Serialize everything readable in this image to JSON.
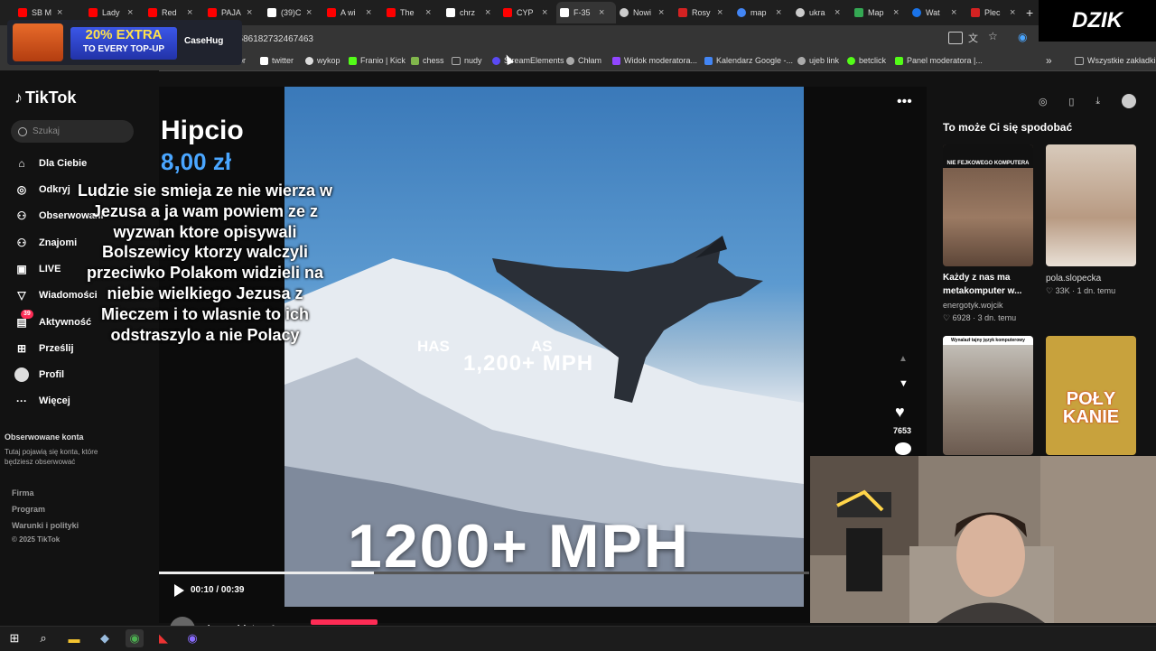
{
  "browser": {
    "tabs": [
      {
        "label": "SB M",
        "icon_color": "#ff0000"
      },
      {
        "label": "Lady",
        "icon_color": "#ff0000"
      },
      {
        "label": "Red",
        "icon_color": "#ff0000"
      },
      {
        "label": "PAJA",
        "icon_color": "#ff0000"
      },
      {
        "label": "(39)C",
        "icon_color": "#ffffff"
      },
      {
        "label": "A wi",
        "icon_color": "#ff0000"
      },
      {
        "label": "The",
        "icon_color": "#ff0000"
      },
      {
        "label": "chrz",
        "icon_color": "#ffffff"
      },
      {
        "label": "CYP",
        "icon_color": "#ff0000"
      },
      {
        "label": "F-35",
        "icon_color": "#ffffff",
        "active": true
      },
      {
        "label": "Nowi",
        "icon_color": "#cccccc"
      },
      {
        "label": "Rosy",
        "icon_color": "#d42222"
      },
      {
        "label": "map",
        "icon_color": "#4285f4"
      },
      {
        "label": "ukra",
        "icon_color": "#cccccc"
      },
      {
        "label": "Map",
        "icon_color": "#34a853"
      },
      {
        "label": "Wat",
        "icon_color": "#1a73e8"
      },
      {
        "label": "Plec",
        "icon_color": "#d42222"
      }
    ],
    "tab_close": "×",
    "new_tab": "+",
    "url": "1586182732467463",
    "bookmarks": [
      {
        "label": "twitter",
        "icon_color": "#ffffff"
      },
      {
        "label": "wykop",
        "icon_color": "#dddddd"
      },
      {
        "label": "Franio | Kick",
        "icon_color": "#53fc18"
      },
      {
        "label": "chess",
        "icon_color": "#81b64c"
      },
      {
        "label": "nudy",
        "icon_color": "#aaaaaa"
      },
      {
        "label": "StreamElements",
        "icon_color": "#5a4af4"
      },
      {
        "label": "Chłam",
        "icon_color": "#aaaaaa"
      },
      {
        "label": "Widok moderatora...",
        "icon_color": "#9146ff"
      },
      {
        "label": "Kalendarz Google -...",
        "icon_color": "#4285f4"
      },
      {
        "label": "ujeb link",
        "icon_color": "#aaaaaa"
      },
      {
        "label": "betclick",
        "icon_color": "#53fc18"
      },
      {
        "label": "Panel moderatora |...",
        "icon_color": "#53fc18"
      }
    ],
    "bookmarks_more": "»",
    "all_bookmarks": "Wszystkie zakładki",
    "fragment_left": "ior"
  },
  "ad": {
    "line1": "20% EXTRA",
    "line2": "TO EVERY TOP-UP",
    "brand": "CaseHug"
  },
  "overlay_brand": "DZIK",
  "tiktok": {
    "logo": "TikTok",
    "search_placeholder": "Szukaj",
    "nav": [
      {
        "label": "Dla Ciebie",
        "icon": "home-icon",
        "glyph": "⌂"
      },
      {
        "label": "Odkryj",
        "icon": "compass-icon",
        "glyph": "◎"
      },
      {
        "label": "Obserwowani",
        "icon": "following-icon",
        "glyph": "⚇"
      },
      {
        "label": "Znajomi",
        "icon": "friends-icon",
        "glyph": "⚇"
      },
      {
        "label": "LIVE",
        "icon": "live-icon",
        "glyph": "▣"
      },
      {
        "label": "Wiadomości",
        "icon": "messages-icon",
        "glyph": "▽"
      },
      {
        "label": "Aktywność",
        "icon": "activity-icon",
        "glyph": "▤",
        "badge": "39"
      },
      {
        "label": "Prześlij",
        "icon": "upload-icon",
        "glyph": "⊞"
      },
      {
        "label": "Profil",
        "icon": "profile-icon",
        "glyph": "●"
      },
      {
        "label": "Więcej",
        "icon": "more-icon",
        "glyph": "···"
      }
    ],
    "followed_title": "Obserwowane konta",
    "followed_desc": "Tutaj pojawią się konta, które będziesz obserwować",
    "footer": [
      "Firma",
      "Program",
      "Warunki i polityki",
      "© 2025 TikTok"
    ]
  },
  "video": {
    "caption_has": "HAS",
    "caption_as": "AS",
    "caption_speed": "1,200+ MPH",
    "big_text": "1200+ MPH",
    "time": "00:10 / 00:39",
    "progress": 0.33,
    "author": "danzz_history1",
    "likes": "7653"
  },
  "donation": {
    "name": "Hipcio",
    "amount": "8,00 zł",
    "message": "Ludzie sie smieja ze nie wierza w Jezusa a ja wam powiem ze z wyzwan ktore opisywali Bolszewicy ktorzy walczyli przeciwko Polakom widzieli na niebie wielkiego Jezusa z Mieczem i to wlasnie to ich odstraszylo a nie Polacy"
  },
  "recommendations": {
    "title": "To może Ci się spodobać",
    "items": [
      {
        "thumb_text": "NIE FEJKOWEGO KOMPUTERA",
        "caption": "Każdy z nas ma metakomputer w...",
        "author": "energotyk.wojcik",
        "likes": "6928",
        "age": "3 dn. temu"
      },
      {
        "thumb_text": "",
        "caption": "",
        "author": "pola.slopecka",
        "likes": "33K",
        "age": "1 dn. temu"
      },
      {
        "thumb_text": "Wynalazł tajny język komputerowy",
        "caption": "",
        "author": "",
        "likes": "",
        "age": ""
      },
      {
        "thumb_text": "POŁY KANIE",
        "caption": "",
        "author": "",
        "likes": "",
        "age": ""
      }
    ]
  },
  "colors": {
    "accent": "#fe2c55",
    "donation_amount": "#4aa6ff"
  }
}
